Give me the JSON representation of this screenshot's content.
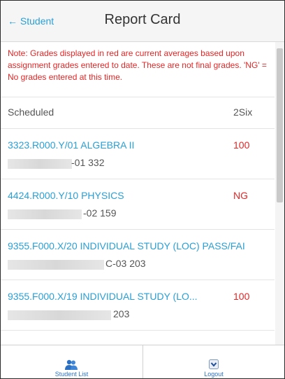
{
  "header": {
    "back_label": "← Student",
    "title": "Report Card"
  },
  "note": "Note: Grades displayed in red are current averages based upon assignment grades entered to date. These are not final grades. 'NG' = No grades entered at this time.",
  "schedule": {
    "label": "Scheduled",
    "column": "2Six"
  },
  "courses": [
    {
      "name": "3323.R000.Y/01 ALGEBRA II",
      "grade": "100",
      "section": "-01 332"
    },
    {
      "name": "4424.R000.Y/10 PHYSICS",
      "grade": "NG",
      "section": "-02 159"
    },
    {
      "name": "9355.F000.X/20 INDIVIDUAL STUDY (LOC) PASS/FAI",
      "grade": "",
      "section": "C-03 203"
    },
    {
      "name": "9355.F000.X/19 INDIVIDUAL STUDY (LO...",
      "grade": "100",
      "section": "203"
    }
  ],
  "footer": {
    "student_list_label": "Student List",
    "logout_label": "Logout",
    "student_list_icon": "people-icon",
    "logout_icon": "chevron-down-icon"
  },
  "colors": {
    "accent": "#2a9fd6",
    "warning": "#e32626"
  }
}
